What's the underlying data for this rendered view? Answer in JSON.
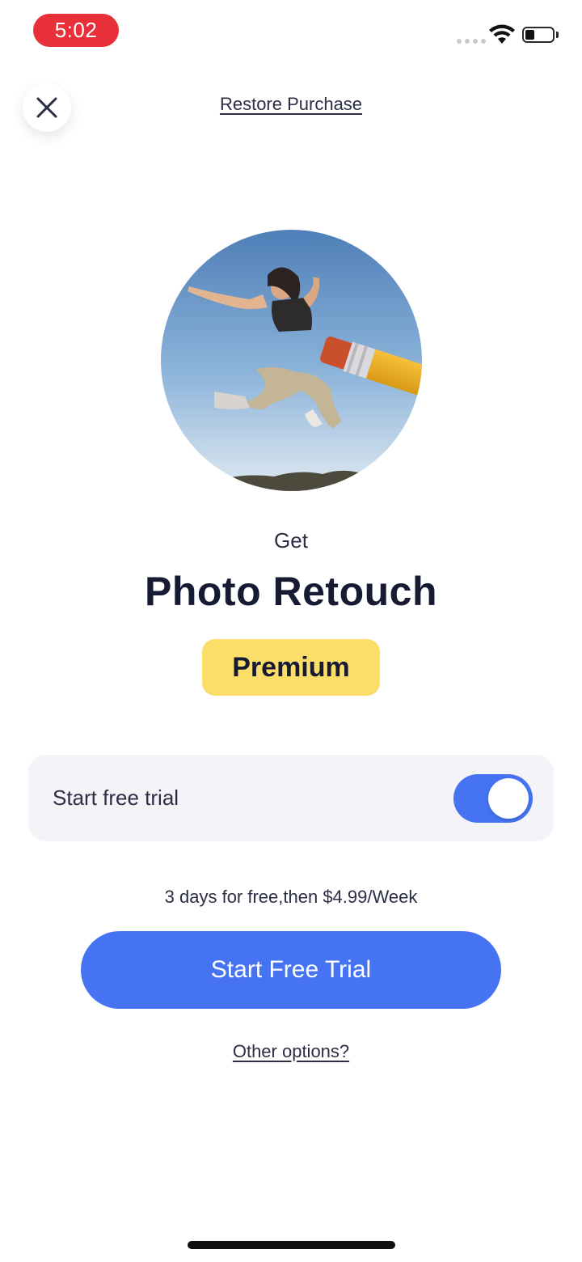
{
  "status_bar": {
    "time": "5:02",
    "icons": [
      "signal-dots-icon",
      "wifi-icon",
      "battery-icon"
    ],
    "time_badge_color": "#e8303a"
  },
  "header": {
    "close_icon": "close-icon",
    "restore_label": "Restore Purchase"
  },
  "hero": {
    "image": "jumping-person-with-eraser-pencil"
  },
  "headline": {
    "get_label": "Get",
    "title": "Photo Retouch",
    "badge": "Premium",
    "badge_color": "#fbdd6a"
  },
  "trial_toggle": {
    "label": "Start free trial",
    "enabled": true,
    "accent": "#4573f2"
  },
  "pricing": {
    "text": "3 days for free,then $4.99/Week"
  },
  "cta": {
    "label": "Start Free Trial",
    "color": "#4573f2"
  },
  "footer": {
    "other_options": "Other options?"
  }
}
